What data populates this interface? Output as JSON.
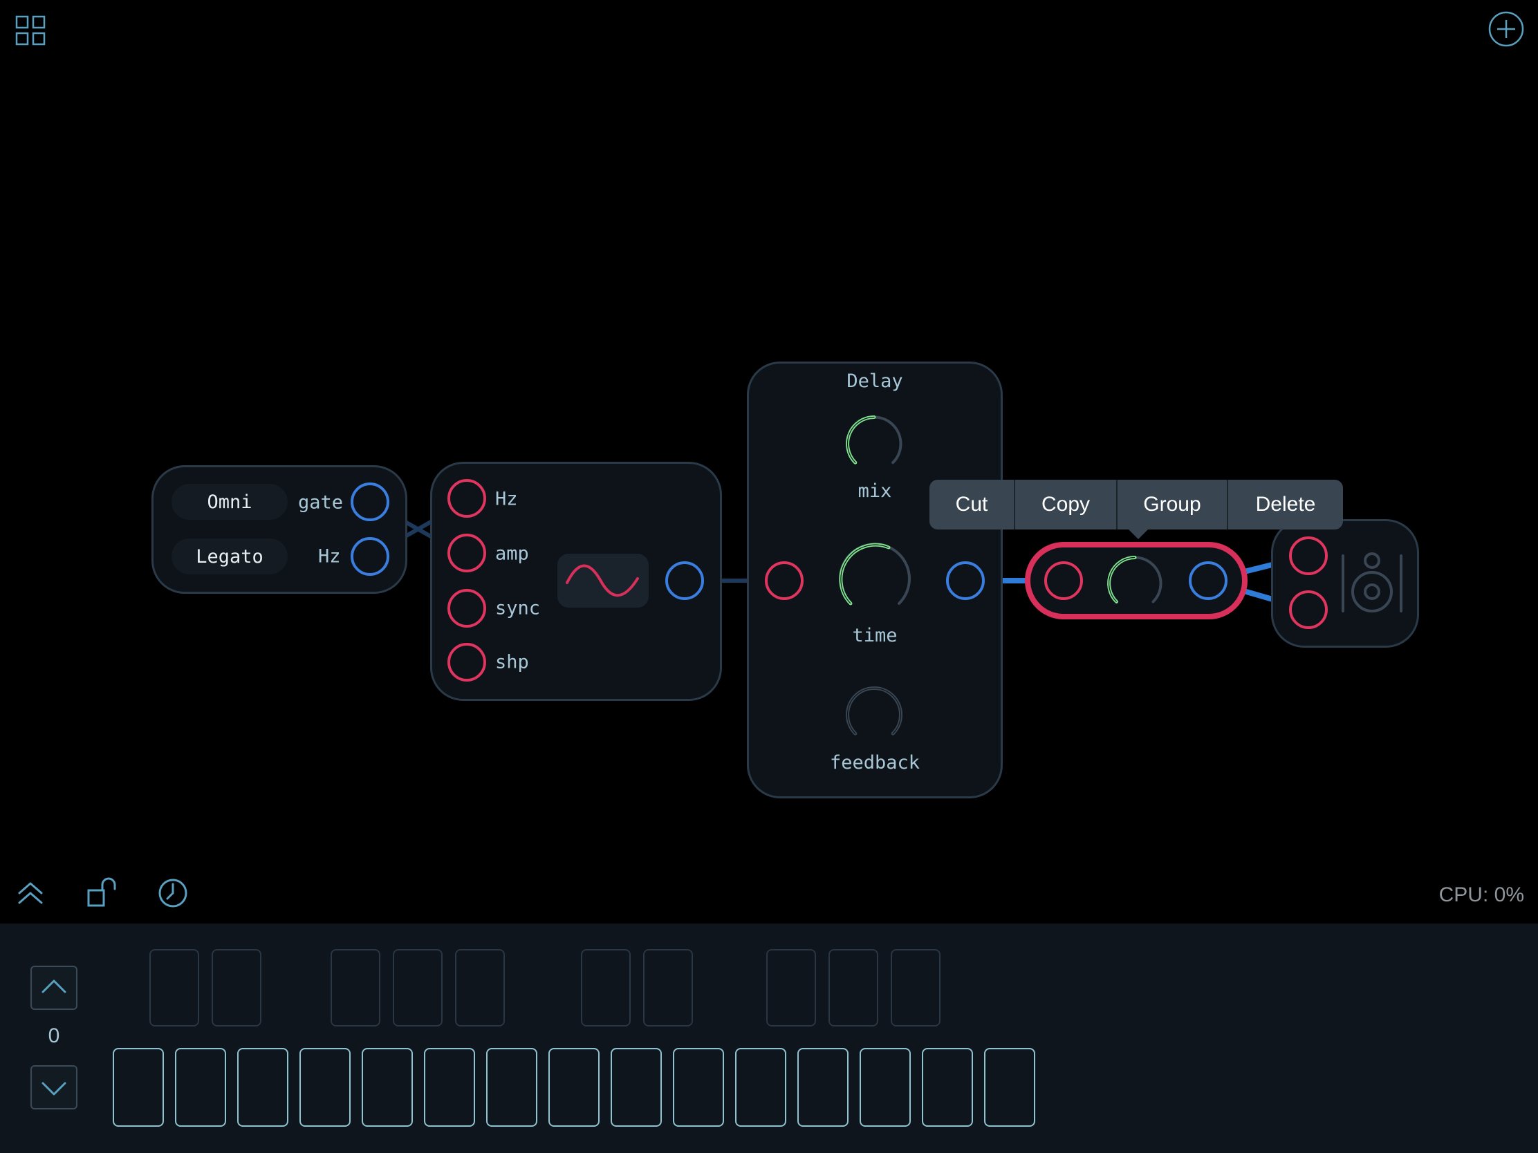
{
  "toolbar_top": {
    "grid_icon": "grid-icon",
    "add_icon": "plus-circle-icon"
  },
  "midi_node": {
    "buttons": [
      "Omni",
      "Legato"
    ],
    "outputs": [
      "gate",
      "Hz"
    ]
  },
  "oscillator_node": {
    "inputs": [
      "Hz",
      "amp",
      "sync",
      "shp"
    ],
    "waveform_icon": "sine-wave-icon"
  },
  "delay_node": {
    "title": "Delay",
    "knobs": [
      {
        "label": "mix",
        "value": 0.45
      },
      {
        "label": "time",
        "value": 0.6
      },
      {
        "label": "feedback",
        "value": 0.0
      }
    ]
  },
  "selected_node": {
    "knob_value": 0.5
  },
  "output_node": {
    "icon": "speaker-icon"
  },
  "context_menu": {
    "items": [
      "Cut",
      "Copy",
      "Group",
      "Delete"
    ]
  },
  "toolbar_bottom": {
    "icons": [
      "collapse-up-icon",
      "unlock-icon",
      "clock-icon"
    ],
    "cpu": "CPU: 0%"
  },
  "keyboard": {
    "octave": "0",
    "white_keys": 15,
    "black_keys": 10
  },
  "colors": {
    "input_port": "#e0355f",
    "output_port": "#3a7fe0",
    "knob_active": "#7ee08c",
    "selection": "#d8305a"
  }
}
